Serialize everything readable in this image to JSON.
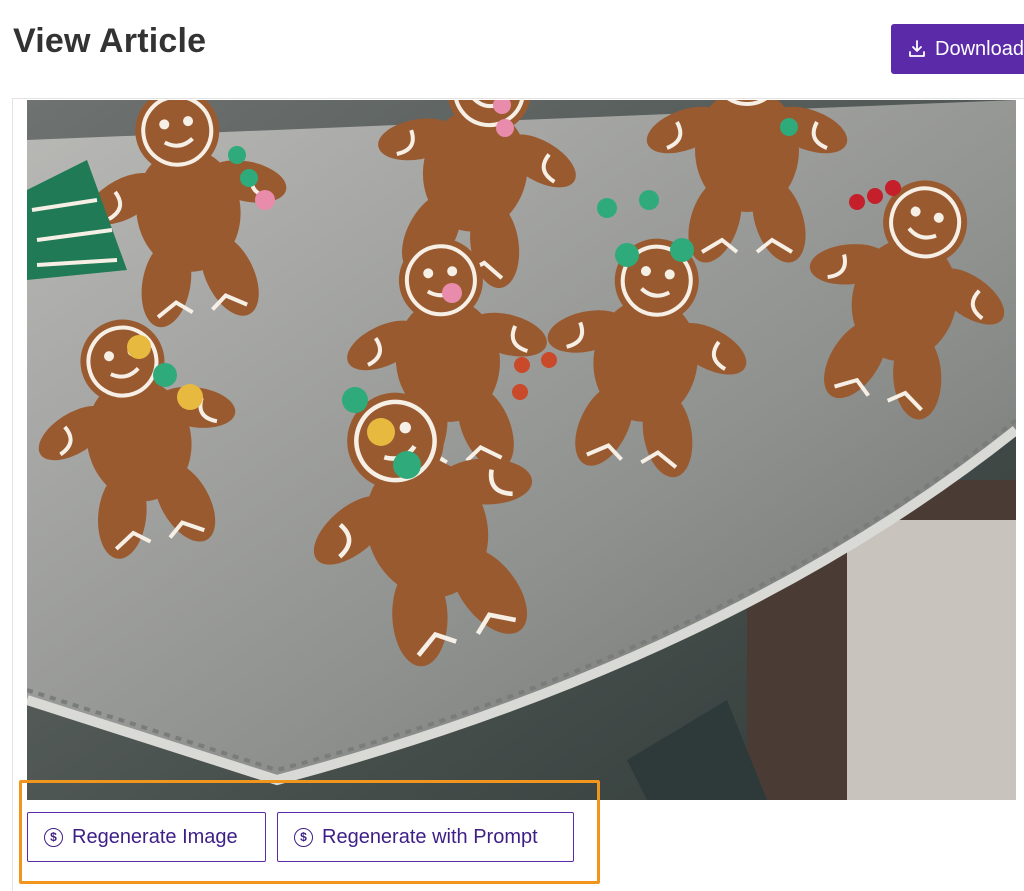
{
  "header": {
    "title": "View Article",
    "download_label": "Download"
  },
  "image": {
    "subject": "Decorated gingerbread cookies on a silver tray"
  },
  "actions": {
    "regenerate_image_label": "Regenerate Image",
    "regenerate_prompt_label": "Regenerate with Prompt",
    "icon_glyph": "$"
  },
  "colors": {
    "accent": "#5b2aa8",
    "highlight": "#f0961f"
  }
}
